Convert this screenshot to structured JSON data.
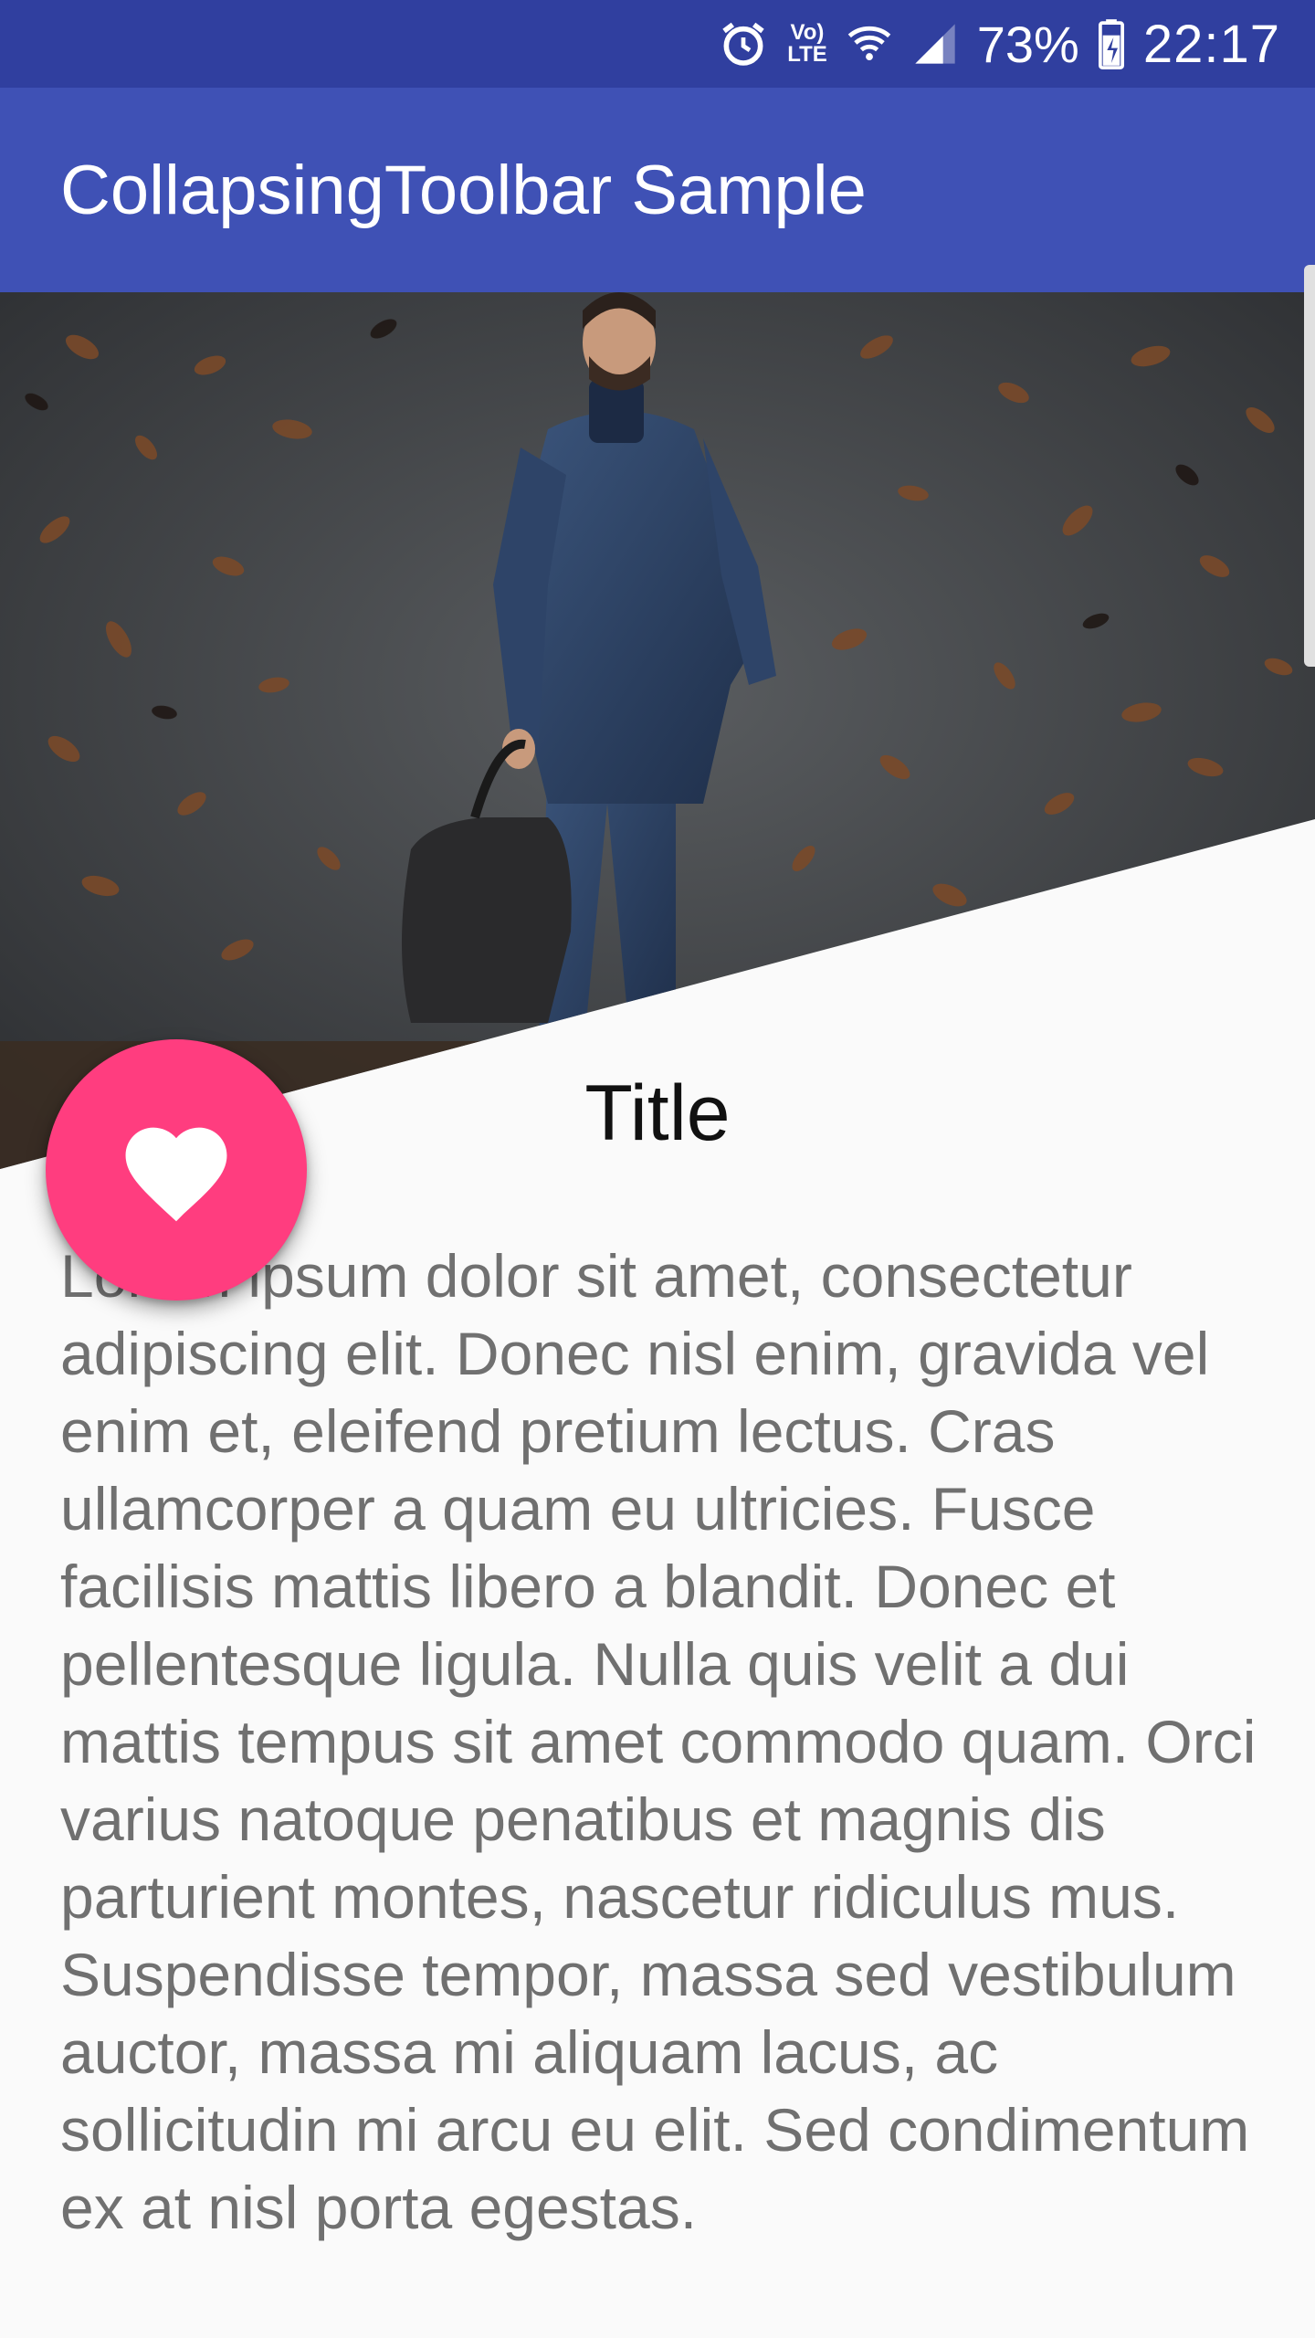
{
  "status_bar": {
    "icons": [
      "alarm-icon",
      "volte-icon",
      "wifi-icon",
      "signal-icon",
      "battery-icon"
    ],
    "volte_line1": "Vo)",
    "volte_line2": "LTE",
    "battery_percent": "73%",
    "time": "22:17"
  },
  "app_bar": {
    "title": "CollapsingToolbar Sample"
  },
  "hero": {
    "description_icon": "hero-photo"
  },
  "fab": {
    "icon": "heart-icon"
  },
  "article": {
    "title": "Title",
    "body": "Lorem ipsum dolor sit amet, consectetur adipiscing elit. Donec nisl enim, gravida vel enim et, eleifend pretium lectus. Cras ullamcorper a quam eu ultricies. Fusce facilisis mattis libero a blandit. Donec et pellentesque ligula. Nulla quis velit a dui mattis tempus sit amet commodo quam. Orci varius natoque penatibus et magnis dis parturient montes, nascetur ridiculus mus. Suspendisse tempor, massa sed vestibulum auctor, massa mi aliquam lacus, ac sollicitudin mi arcu eu elit. Sed condimentum ex at nisl porta egestas."
  },
  "colors": {
    "status_bar": "#303F9F",
    "app_bar": "#3F51B5",
    "fab": "#FF3D7F",
    "background": "#FAFAFA",
    "body_text": "#707070"
  }
}
